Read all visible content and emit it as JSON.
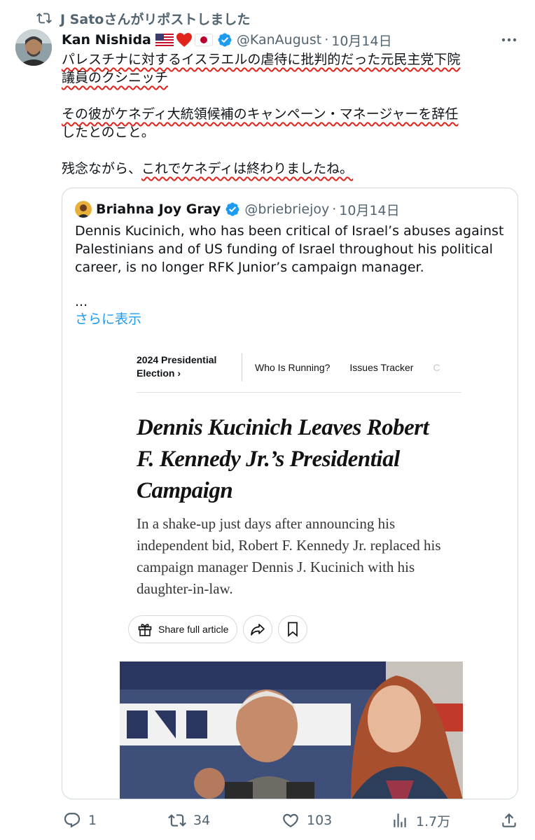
{
  "repost": {
    "text": "J Satoさんがリポストしました",
    "icon": "repost-icon"
  },
  "tweet": {
    "author_name": "Kan Nishida",
    "author_emoji": [
      "flag-us",
      "red-heart",
      "flag-jp"
    ],
    "verified": true,
    "handle": "@KanAugust",
    "separator": "·",
    "date": "10月14日",
    "lines": {
      "p1a": "パレスチナに対するイスラエルの虐待に批判的だった元民主党下院",
      "p1b": "議員のクシニッチ",
      "p2a": "その彼がケネディ大統領候補のキャンペーン・マネージャーを辞任",
      "p2b": "したとのこと。",
      "p3_prefix": "残念ながら、",
      "p3_underlined": "これでケネディは終わりましたね。"
    }
  },
  "quote": {
    "author_name": "Briahna Joy Gray",
    "verified": true,
    "handle": "@briebriejoy",
    "separator": "·",
    "date": "10月14日",
    "text": "Dennis Kucinich, who has been critical of Israel’s abuses against Palestinians and of US funding of Israel throughout his political career, is no longer RFK Junior’s campaign manager.",
    "ellipsis": "...",
    "show_more": "さらに表示",
    "article": {
      "election_label_1": "2024 Presidential",
      "election_label_2": "Election ›",
      "nav_items": [
        "Who Is Running?",
        "Issues Tracker",
        "C"
      ],
      "headline": "Dennis Kucinich Leaves Robert F. Kennedy Jr.’s Presidential Campaign",
      "summary": "In a shake-up just days after announcing his independent bid, Robert F. Kennedy Jr. replaced his campaign manager Dennis J. Kucinich with his daughter-in-law.",
      "share_label": "Share full article"
    }
  },
  "stats": {
    "replies": "1",
    "reposts": "34",
    "likes": "103",
    "views": "1.7万"
  },
  "colors": {
    "accent": "#1d9bf0",
    "muted": "#536471",
    "underline": "#e0241b",
    "border": "#cfd9de"
  }
}
